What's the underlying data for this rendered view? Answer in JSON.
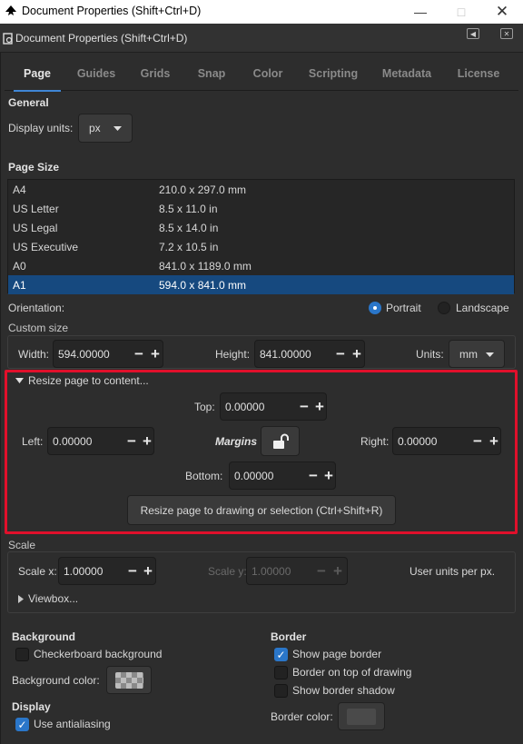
{
  "window": {
    "title": "Document Properties (Shift+Ctrl+D)"
  },
  "dock": {
    "title": "Document Properties (Shift+Ctrl+D)"
  },
  "tabs": [
    "Page",
    "Guides",
    "Grids",
    "Snap",
    "Color",
    "Scripting",
    "Metadata",
    "License"
  ],
  "general": {
    "heading": "General",
    "display_units_label": "Display units:",
    "display_units_value": "px"
  },
  "page_size": {
    "heading": "Page Size",
    "rows": [
      {
        "name": "A4",
        "size": "210.0 x 297.0 mm"
      },
      {
        "name": "US Letter",
        "size": "8.5 x 11.0 in"
      },
      {
        "name": "US Legal",
        "size": "8.5 x 14.0 in"
      },
      {
        "name": "US Executive",
        "size": "7.2 x 10.5 in"
      },
      {
        "name": "A0",
        "size": "841.0 x 1189.0 mm"
      },
      {
        "name": "A1",
        "size": "594.0 x 841.0 mm"
      }
    ],
    "selected": "A1"
  },
  "orientation": {
    "label": "Orientation:",
    "portrait": "Portrait",
    "landscape": "Landscape",
    "selected": "Portrait"
  },
  "custom_size": {
    "heading": "Custom size",
    "width_label": "Width:",
    "width": "594.00000",
    "height_label": "Height:",
    "height": "841.00000",
    "units_label": "Units:",
    "units": "mm"
  },
  "resize": {
    "expander": "Resize page to content...",
    "top_label": "Top:",
    "top": "0.00000",
    "left_label": "Left:",
    "left": "0.00000",
    "margins_label": "Margins",
    "right_label": "Right:",
    "right": "0.00000",
    "bottom_label": "Bottom:",
    "bottom": "0.00000",
    "button": "Resize page to drawing or selection (Ctrl+Shift+R)"
  },
  "scale": {
    "heading": "Scale",
    "x_label": "Scale x:",
    "x": "1.00000",
    "y_label": "Scale y:",
    "y": "1.00000",
    "units_text": "User units per px.",
    "viewbox": "Viewbox..."
  },
  "background": {
    "heading": "Background",
    "checkerboard": "Checkerboard background",
    "checkerboard_on": false,
    "color_label": "Background color:"
  },
  "display": {
    "heading": "Display",
    "antialias": "Use antialiasing",
    "antialias_on": true
  },
  "border": {
    "heading": "Border",
    "show_border": "Show page border",
    "show_border_on": true,
    "on_top": "Border on top of drawing",
    "on_top_on": false,
    "shadow": "Show border shadow",
    "shadow_on": false,
    "color_label": "Border color:"
  },
  "colors": {
    "accent": "#3f86d5",
    "selection": "#16497f",
    "highlight": "#e0102b",
    "check": "#2a76c9"
  }
}
